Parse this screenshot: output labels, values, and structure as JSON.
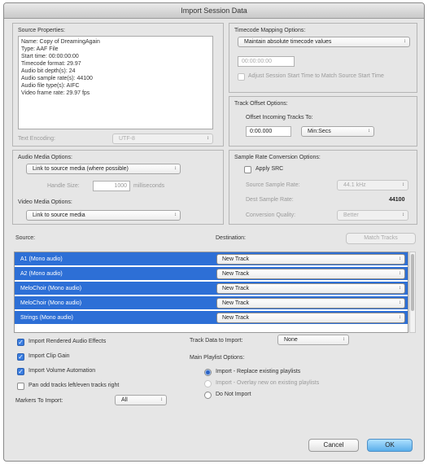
{
  "window": {
    "title": "Import Session Data"
  },
  "source_properties": {
    "heading": "Source Properties:",
    "lines": [
      "Name: Copy of DreamingAgain",
      "Type: AAF File",
      "Start time: 00:00:00:00",
      "Timecode format: 29.97",
      "Audio bit depth(s): 24",
      "Audio sample rate(s): 44100",
      "Audio file type(s): AIFC",
      "Video frame rate: 29.97 fps"
    ],
    "text_encoding_label": "Text Encoding:",
    "text_encoding_value": "UTF-8"
  },
  "timecode": {
    "heading": "Timecode Mapping Options:",
    "mode": "Maintain absolute timecode values",
    "timecode_value": "00:00:00:00",
    "adjust_label": "Adjust Session Start Time to Match Source Start Time"
  },
  "track_offset": {
    "heading": "Track Offset Options:",
    "offset_label": "Offset Incoming Tracks To:",
    "offset_value": "0:00.000",
    "offset_unit": "Min:Secs"
  },
  "audio_media": {
    "heading": "Audio Media Options:",
    "mode": "Link to source media (where possible)",
    "handle_label": "Handle Size:",
    "handle_value": "1000",
    "handle_unit": "milliseconds"
  },
  "video_media": {
    "heading": "Video Media Options:",
    "mode": "Link to source media"
  },
  "sample_rate": {
    "heading": "Sample Rate Conversion Options:",
    "apply_src_label": "Apply SRC",
    "source_rate_label": "Source Sample Rate:",
    "source_rate_value": "44.1 kHz",
    "dest_rate_label": "Dest Sample Rate:",
    "dest_rate_value": "44100",
    "quality_label": "Conversion Quality:",
    "quality_value": "Better"
  },
  "tracks": {
    "source_header": "Source:",
    "destination_header": "Destination:",
    "match_button": "Match Tracks",
    "rows": [
      {
        "source": "A1 (Mono audio)",
        "destination": "New Track"
      },
      {
        "source": "A2 (Mono audio)",
        "destination": "New Track"
      },
      {
        "source": "MeloChoir (Mono audio)",
        "destination": "New Track"
      },
      {
        "source": "MeloChoir (Mono audio)",
        "destination": "New Track"
      },
      {
        "source": "Strings (Mono audio)",
        "destination": "New Track"
      }
    ]
  },
  "options": {
    "rendered_effects": "Import Rendered Audio Effects",
    "clip_gain": "Import Clip Gain",
    "volume_automation": "Import Volume Automation",
    "pan_odd_even": "Pan odd tracks left/even tracks right",
    "markers_label": "Markers To Import:",
    "markers_value": "All",
    "track_data_label": "Track Data to Import:",
    "track_data_value": "None",
    "playlist_heading": "Main Playlist Options:",
    "playlist_replace": "Import - Replace existing playlists",
    "playlist_overlay": "Import - Overlay new on existing playlists",
    "playlist_none": "Do Not Import"
  },
  "buttons": {
    "cancel": "Cancel",
    "ok": "OK"
  }
}
